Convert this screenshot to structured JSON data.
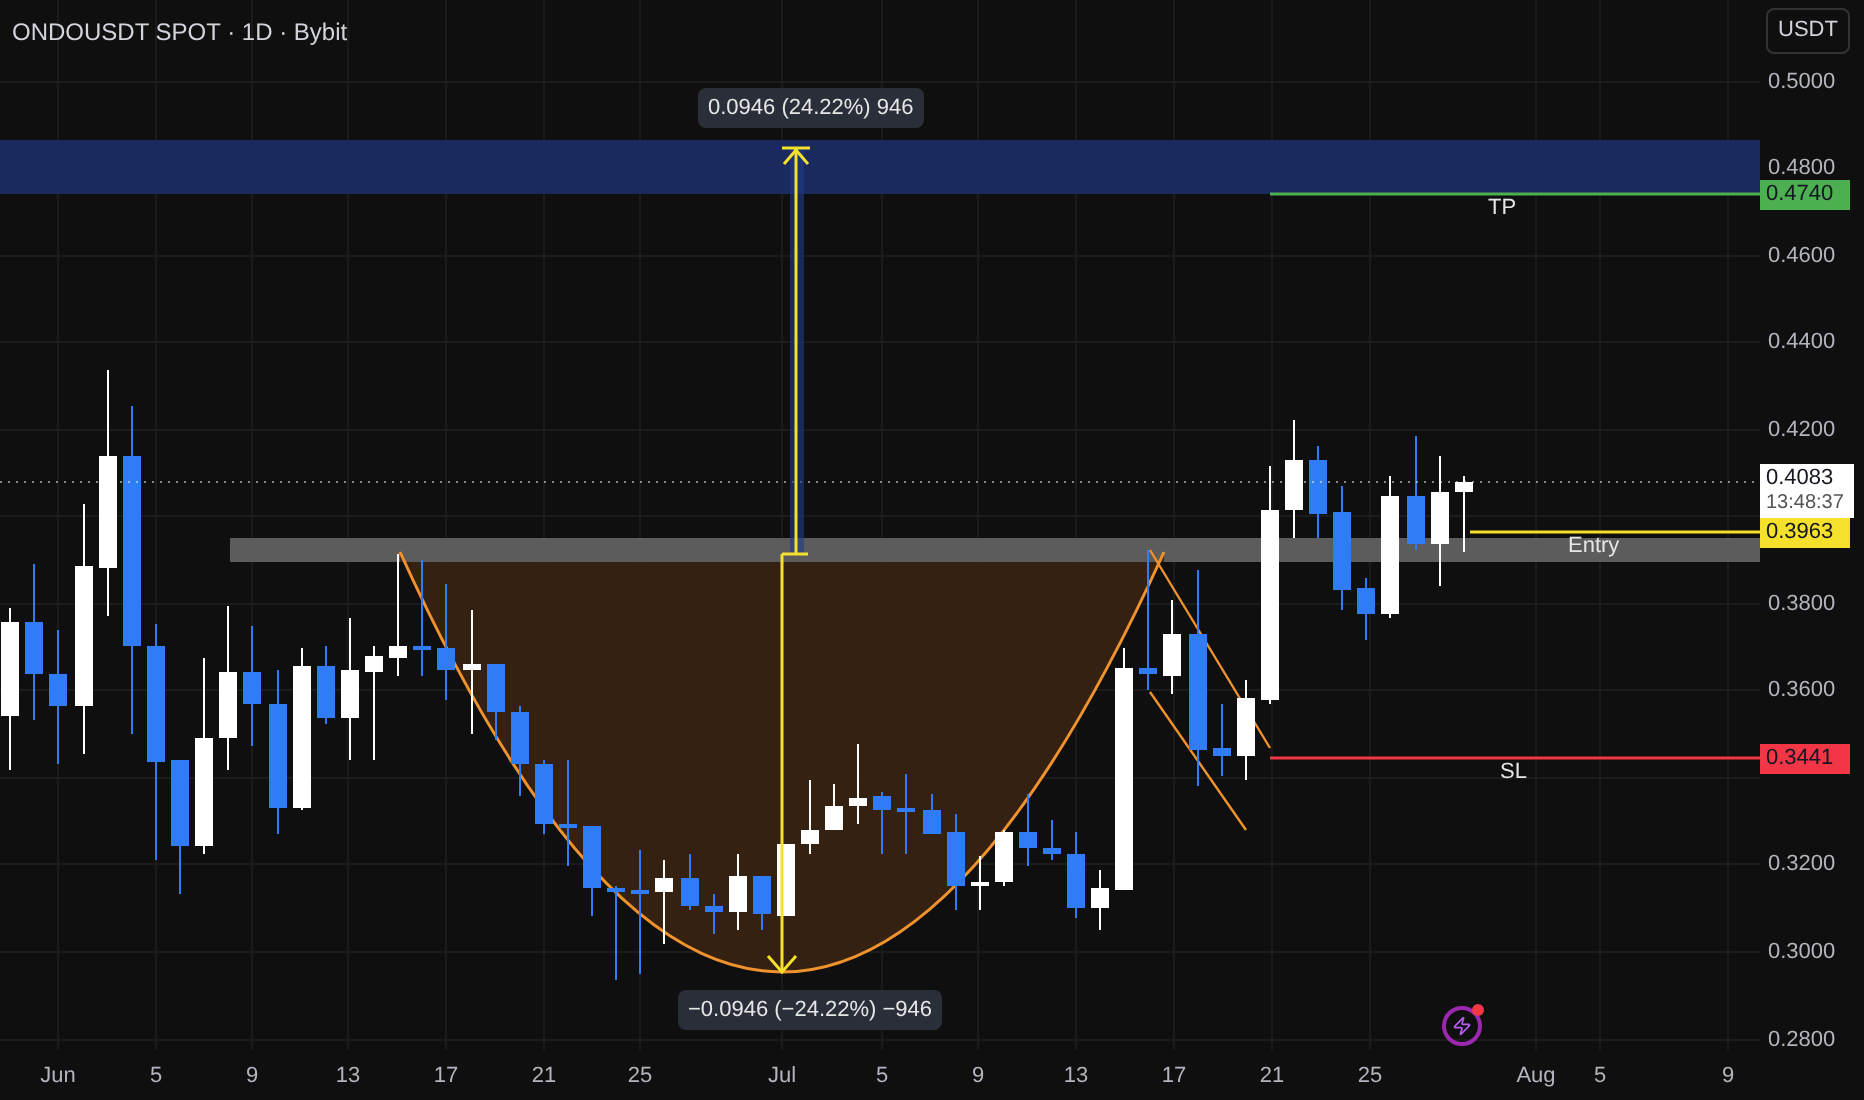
{
  "title": "ONDOUSDT SPOT · 1D · Bybit",
  "currency_button": "USDT",
  "price_axis": [
    "0.5000",
    "0.4800",
    "0.4600",
    "0.4400",
    "0.4200",
    "0.3800",
    "0.3600",
    "0.3200",
    "0.3000",
    "0.2800"
  ],
  "time_axis": [
    "Jun",
    "5",
    "9",
    "13",
    "17",
    "21",
    "25",
    "Jul",
    "5",
    "9",
    "13",
    "17",
    "21",
    "25",
    "Aug",
    "5",
    "9"
  ],
  "levels": [
    {
      "kind": "take_profit",
      "label": "TP",
      "price_tag": "0.4740",
      "color": "#4caf50"
    },
    {
      "kind": "last",
      "price_tag": "0.4083",
      "countdown": "13:48:37",
      "color": "#ffffff"
    },
    {
      "kind": "entry",
      "label": "Entry",
      "price_tag": "0.3963",
      "color": "#f5e12b"
    },
    {
      "kind": "stop_loss",
      "label": "SL",
      "price_tag": "0.3441",
      "color": "#f23645"
    }
  ],
  "measurements": [
    {
      "kind": "up",
      "label": "0.0946 (24.22%) 946"
    },
    {
      "kind": "down",
      "label": "−0.0946 (−24.22%) −946"
    }
  ]
}
